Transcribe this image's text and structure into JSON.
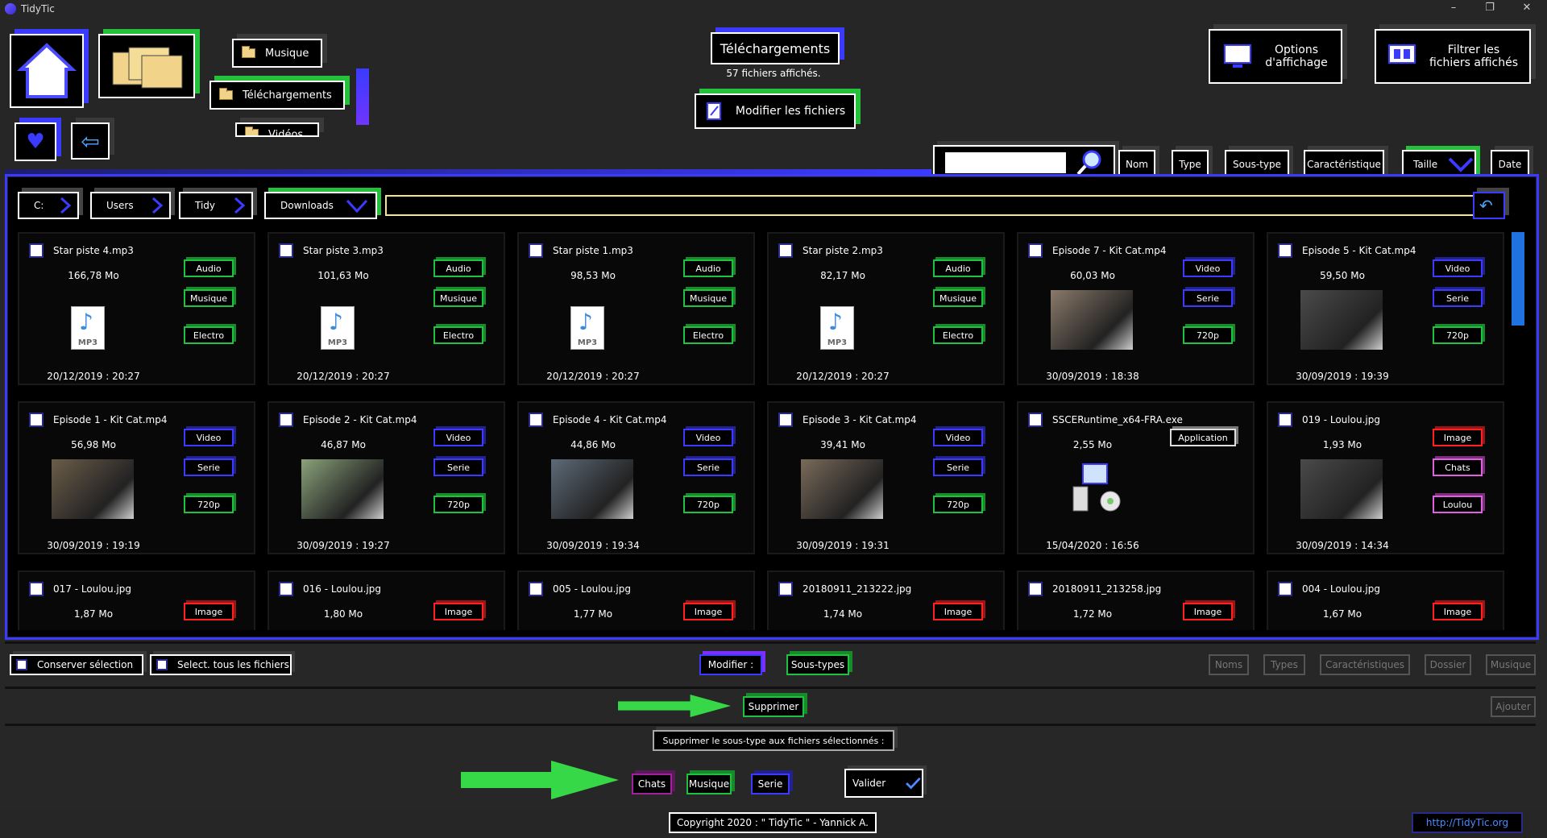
{
  "app": {
    "title": "TidyTic",
    "win_min": "–",
    "win_max": "❐",
    "win_close": "✕"
  },
  "quick": {
    "musique": "Musique",
    "telechargements": "Téléchargements",
    "videos": "Vidéos"
  },
  "header": {
    "folder": "Téléchargements",
    "count": "57 fichiers affichés.",
    "modify": "Modifier les fichiers",
    "options": "Options\nd'affichage",
    "filter": "Filtrer les\nfichiers affichés"
  },
  "search": {
    "placeholder": ""
  },
  "sort": {
    "nom": "Nom",
    "type": "Type",
    "sous_type": "Sous-type",
    "caracteristique": "Caractéristique",
    "taille": "Taille",
    "date": "Date"
  },
  "breadcrumb": [
    "C:",
    "Users",
    "Tidy",
    "Downloads"
  ],
  "files": [
    {
      "name": "Star piste 4.mp3",
      "size": "166,78 Mo",
      "date": "20/12/2019 : 20:27",
      "tags": [
        "Audio",
        "Musique",
        "Electro"
      ],
      "kind": "mp3"
    },
    {
      "name": "Star piste 3.mp3",
      "size": "101,63 Mo",
      "date": "20/12/2019 : 20:27",
      "tags": [
        "Audio",
        "Musique",
        "Electro"
      ],
      "kind": "mp3"
    },
    {
      "name": "Star piste 1.mp3",
      "size": "98,53 Mo",
      "date": "20/12/2019 : 20:27",
      "tags": [
        "Audio",
        "Musique",
        "Electro"
      ],
      "kind": "mp3"
    },
    {
      "name": "Star piste 2.mp3",
      "size": "82,17 Mo",
      "date": "20/12/2019 : 20:27",
      "tags": [
        "Audio",
        "Musique",
        "Electro"
      ],
      "kind": "mp3"
    },
    {
      "name": "Episode 7 - Kit Cat.mp4",
      "size": "60,03 Mo",
      "date": "30/09/2019 : 18:38",
      "tags": [
        "Video",
        "Serie",
        "720p"
      ],
      "kind": "video"
    },
    {
      "name": "Episode 5 - Kit Cat.mp4",
      "size": "59,50 Mo",
      "date": "30/09/2019 : 19:39",
      "tags": [
        "Video",
        "Serie",
        "720p"
      ],
      "kind": "video"
    },
    {
      "name": "Episode 1 - Kit Cat.mp4",
      "size": "56,98 Mo",
      "date": "30/09/2019 : 19:19",
      "tags": [
        "Video",
        "Serie",
        "720p"
      ],
      "kind": "video"
    },
    {
      "name": "Episode 2 - Kit Cat.mp4",
      "size": "46,87 Mo",
      "date": "30/09/2019 : 19:27",
      "tags": [
        "Video",
        "Serie",
        "720p"
      ],
      "kind": "video"
    },
    {
      "name": "Episode 4 - Kit Cat.mp4",
      "size": "44,86 Mo",
      "date": "30/09/2019 : 19:34",
      "tags": [
        "Video",
        "Serie",
        "720p"
      ],
      "kind": "video"
    },
    {
      "name": "Episode 3 - Kit Cat.mp4",
      "size": "39,41 Mo",
      "date": "30/09/2019 : 19:31",
      "tags": [
        "Video",
        "Serie",
        "720p"
      ],
      "kind": "video"
    },
    {
      "name": "SSCERuntime_x64-FRA.exe",
      "size": "2,55 Mo",
      "date": "15/04/2020 : 16:56",
      "tags": [
        "Application"
      ],
      "kind": "exe"
    },
    {
      "name": "019 - Loulou.jpg",
      "size": "1,93 Mo",
      "date": "30/09/2019 : 14:34",
      "tags": [
        "Image",
        "Chats",
        "Loulou"
      ],
      "kind": "image"
    },
    {
      "name": "017 - Loulou.jpg",
      "size": "1,87 Mo",
      "date": "",
      "tags": [
        "Image"
      ],
      "kind": "image"
    },
    {
      "name": "016 - Loulou.jpg",
      "size": "1,80 Mo",
      "date": "",
      "tags": [
        "Image"
      ],
      "kind": "image"
    },
    {
      "name": "005 - Loulou.jpg",
      "size": "1,77 Mo",
      "date": "",
      "tags": [
        "Image"
      ],
      "kind": "image"
    },
    {
      "name": "20180911_213222.jpg",
      "size": "1,74 Mo",
      "date": "",
      "tags": [
        "Image"
      ],
      "kind": "image"
    },
    {
      "name": "20180911_213258.jpg",
      "size": "1,72 Mo",
      "date": "",
      "tags": [
        "Image"
      ],
      "kind": "image"
    },
    {
      "name": "004 - Loulou.jpg",
      "size": "1,67 Mo",
      "date": "",
      "tags": [
        "Image"
      ],
      "kind": "image"
    }
  ],
  "bottom": {
    "conserver": "Conserver sélection",
    "select_all": "Select. tous les fichiers",
    "modifier": "Modifier :",
    "sous_types": "Sous-types",
    "noms": "Noms",
    "types": "Types",
    "caracteristiques": "Caractéristiques",
    "dossier": "Dossier",
    "musique": "Musique",
    "supprimer": "Supprimer",
    "ajouter": "Ajouter",
    "info": "Supprimer le sous-type aux fichiers sélectionnés :",
    "chats": "Chats",
    "musique2": "Musique",
    "serie": "Serie",
    "valider": "Valider"
  },
  "footer": {
    "copyright": "Copyright 2020 : \" TidyTic \" - Yannick A.",
    "link": "http://TidyTic.org"
  },
  "colors": {
    "accent_blue": "#3b3bff",
    "accent_green": "#25c13a",
    "tag_red": "#ff2020",
    "tag_purple": "#e060e0"
  }
}
